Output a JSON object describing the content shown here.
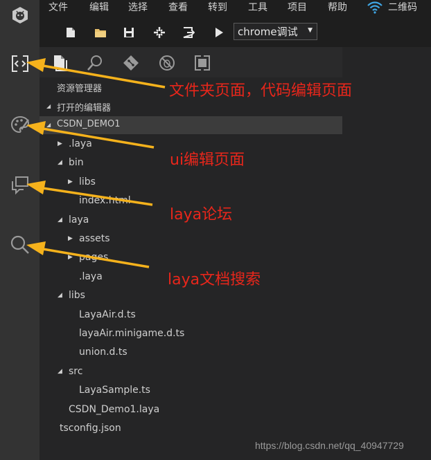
{
  "menubar": {
    "items": [
      "文件",
      "编辑",
      "选择",
      "查看",
      "转到",
      "工具",
      "项目",
      "帮助"
    ],
    "qrcode_label": "二维码"
  },
  "toolbar": {
    "config_selected": "chrome调试"
  },
  "sidebar": {
    "explorer_header": "资源管理器",
    "open_editors_header": "打开的编辑器",
    "project_header": "CSDN_DEMO1",
    "tree": [
      {
        "label": ".laya",
        "depth": 1,
        "toggle": "collapsed"
      },
      {
        "label": "bin",
        "depth": 1,
        "toggle": "expanded"
      },
      {
        "label": "libs",
        "depth": 2,
        "toggle": "collapsed"
      },
      {
        "label": "index.html",
        "depth": 2,
        "toggle": "none"
      },
      {
        "label": "laya",
        "depth": 1,
        "toggle": "expanded"
      },
      {
        "label": "assets",
        "depth": 2,
        "toggle": "collapsed"
      },
      {
        "label": "pages",
        "depth": 2,
        "toggle": "collapsed"
      },
      {
        "label": ".laya",
        "depth": 2,
        "toggle": "none"
      },
      {
        "label": "libs",
        "depth": 1,
        "toggle": "expanded"
      },
      {
        "label": "LayaAir.d.ts",
        "depth": 2,
        "toggle": "none"
      },
      {
        "label": "layaAir.minigame.d.ts",
        "depth": 2,
        "toggle": "none"
      },
      {
        "label": "union.d.ts",
        "depth": 2,
        "toggle": "none"
      },
      {
        "label": "src",
        "depth": 1,
        "toggle": "expanded"
      },
      {
        "label": "LayaSample.ts",
        "depth": 2,
        "toggle": "none"
      },
      {
        "label": "CSDN_Demo1.laya",
        "depth": 1,
        "toggle": "none"
      },
      {
        "label": "tsconfig.json",
        "depth": 0,
        "toggle": "none"
      }
    ]
  },
  "annotations": {
    "folder_page": "文件夹页面，代码编辑页面",
    "ui_editor": "ui编辑页面",
    "forum": "laya论坛",
    "docs_search": "laya文档搜索"
  },
  "watermark": "https://blog.csdn.net/qq_40947729",
  "colors": {
    "accent_arrow": "#f5b21c",
    "annotation_text": "#e8261b",
    "activity_bar": "#333333",
    "sidebar": "#252526",
    "editor": "#1e1e1e"
  }
}
